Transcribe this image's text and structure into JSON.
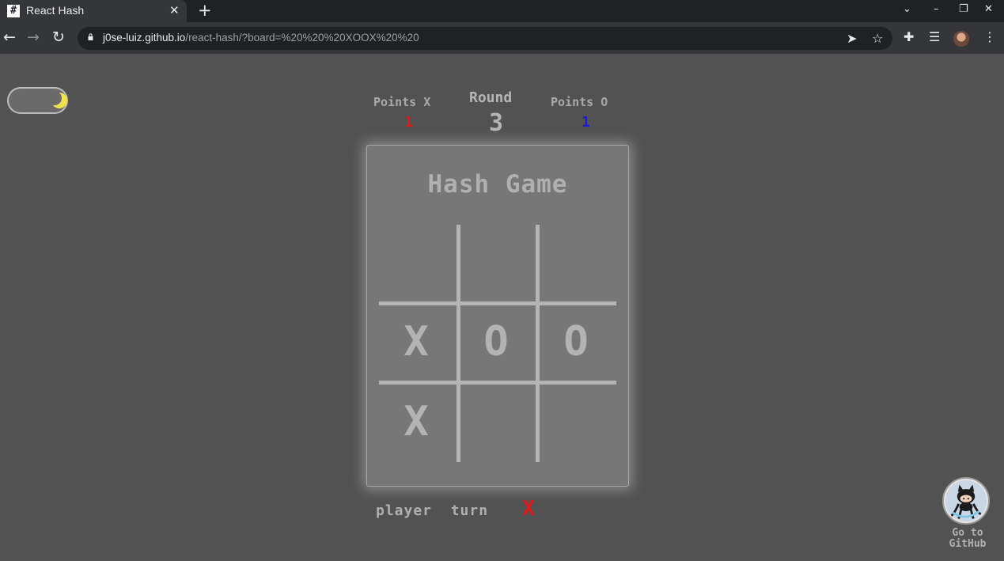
{
  "browser": {
    "tab_title": "React Hash",
    "tab_favicon": "#",
    "url_host": "j0se-luiz.github.io",
    "url_path": "/react-hash/?board=%20%20%20XOOX%20%20"
  },
  "scoreboard": {
    "points_x_label": "Points X",
    "points_x_value": "1",
    "round_label": "Round",
    "round_value": "3",
    "points_o_label": "Points O",
    "points_o_value": "1"
  },
  "game": {
    "title": "Hash Game",
    "board": [
      "",
      "",
      "",
      "X",
      "O",
      "O",
      "X",
      "",
      ""
    ]
  },
  "turn": {
    "label": "player  turn",
    "mark": "X"
  },
  "github": {
    "label_line1": "Go to",
    "label_line2": "GitHub"
  },
  "colors": {
    "background": "#525252",
    "card": "#777777",
    "x_score": "#e01a1a",
    "o_score": "#1a1ae0",
    "moon": "#f0e24a"
  },
  "icons": {
    "theme_toggle": "moon-icon",
    "github": "octocat-icon"
  }
}
